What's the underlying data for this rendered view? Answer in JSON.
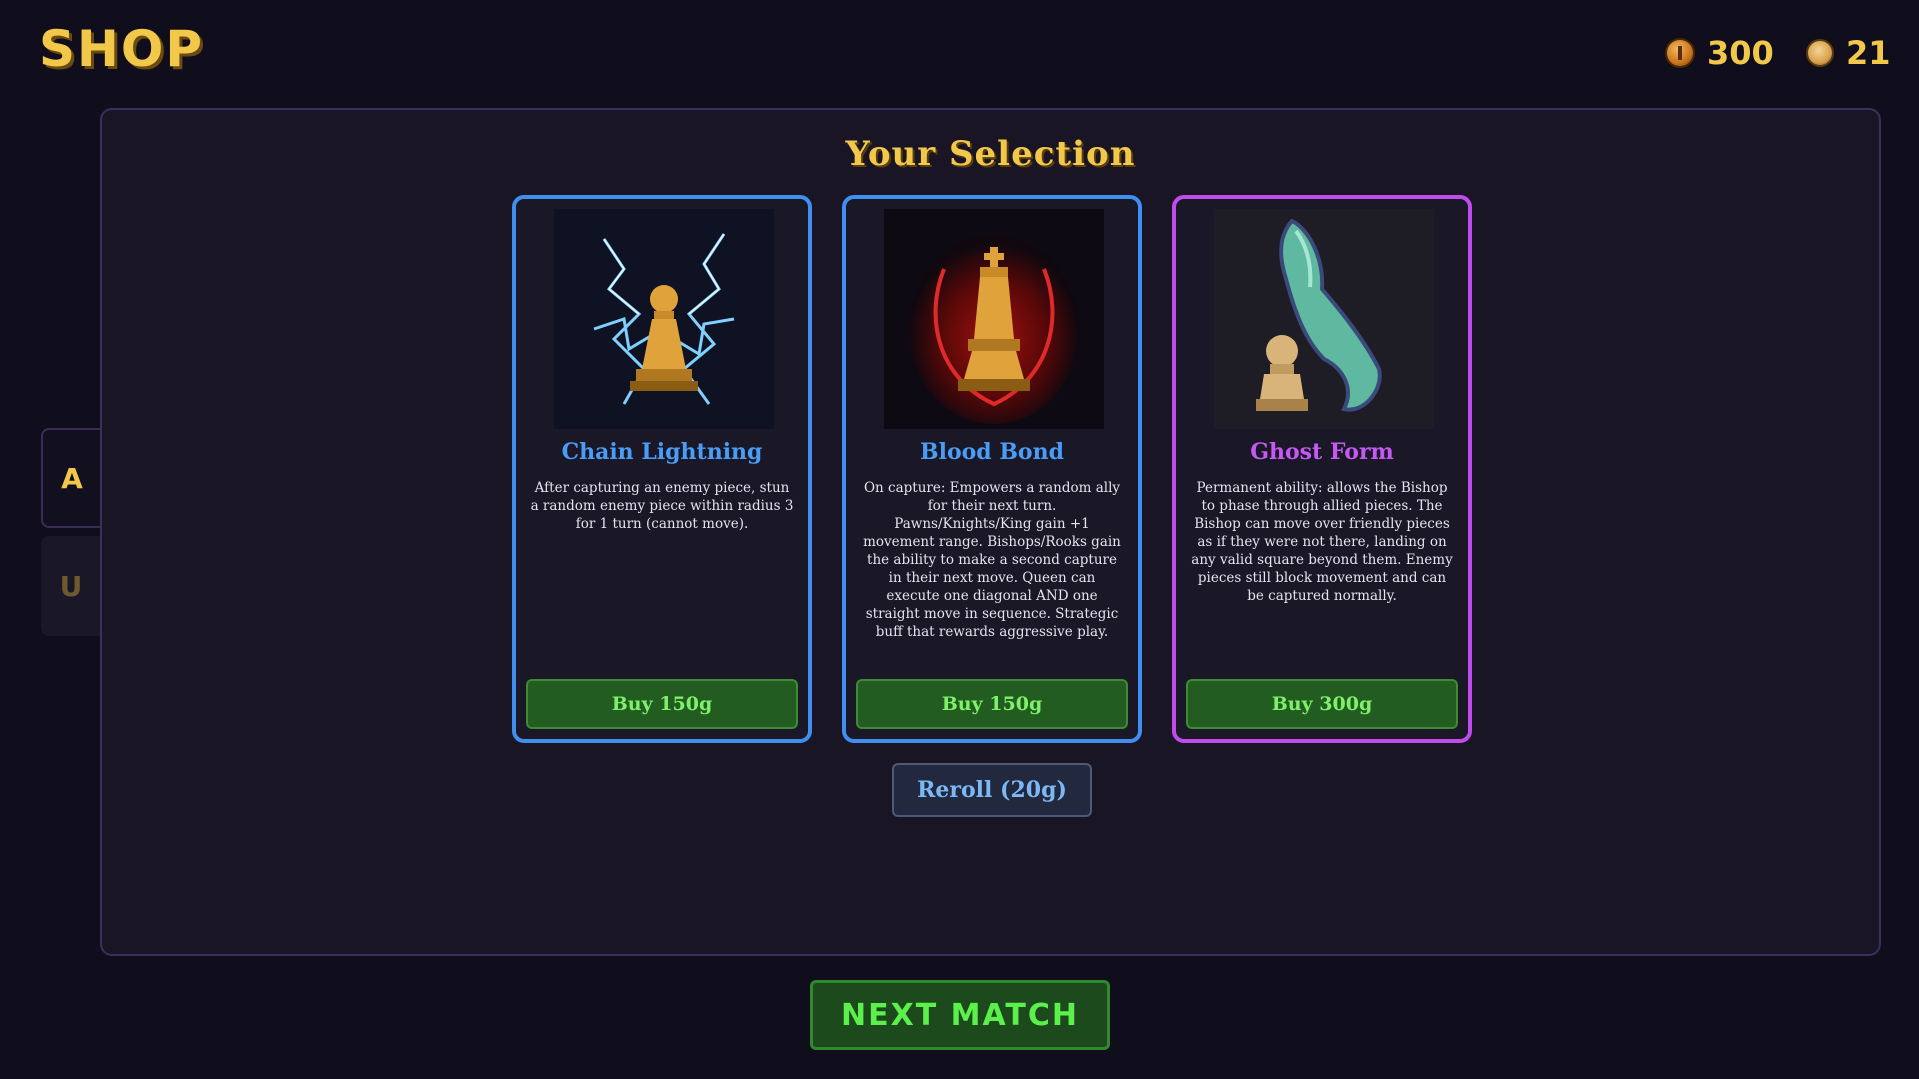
{
  "header": {
    "title": "SHOP"
  },
  "currency": {
    "gold": {
      "icon": "coin-icon",
      "value": "300"
    },
    "gems": {
      "icon": "token-icon",
      "value": "21"
    }
  },
  "side_tabs": [
    {
      "label": "A",
      "active": true
    },
    {
      "label": "U",
      "active": false
    }
  ],
  "panel": {
    "title": "Your Selection"
  },
  "cards": [
    {
      "name": "Chain Lightning",
      "description": "After capturing an enemy piece, stun a random enemy piece within radius 3 for 1 turn (cannot move).",
      "buy_label": "Buy 150g",
      "border_color": "#3e8ff0",
      "art_icon": "pawn-lightning-icon"
    },
    {
      "name": "Blood Bond",
      "description": "On capture: Empowers a random ally for their next turn. Pawns/Knights/King gain +1 movement range. Bishops/Rooks gain the ability to make a second capture in their next move. Queen can execute one diagonal AND one straight move in sequence. Strategic buff that rewards aggressive play.",
      "buy_label": "Buy 150g",
      "border_color": "#3e8ff0",
      "art_icon": "king-blood-aura-icon"
    },
    {
      "name": "Ghost Form",
      "description": "Permanent ability: allows the Bishop to phase through allied pieces. The Bishop can move over friendly pieces as if they were not there, landing on any valid square beyond them. Enemy pieces still block movement and can be captured normally.",
      "buy_label": "Buy 300g",
      "border_color": "#c04cf0",
      "art_icon": "ghost-bishop-icon"
    }
  ],
  "reroll": {
    "label": "Reroll (20g)"
  },
  "next_match": {
    "label": "NEXT MATCH"
  },
  "colors": {
    "accent_gold": "#f2c84b",
    "rare_blue": "#3e8ff0",
    "epic_purple": "#c04cf0",
    "buy_green": "#7ff06a"
  }
}
